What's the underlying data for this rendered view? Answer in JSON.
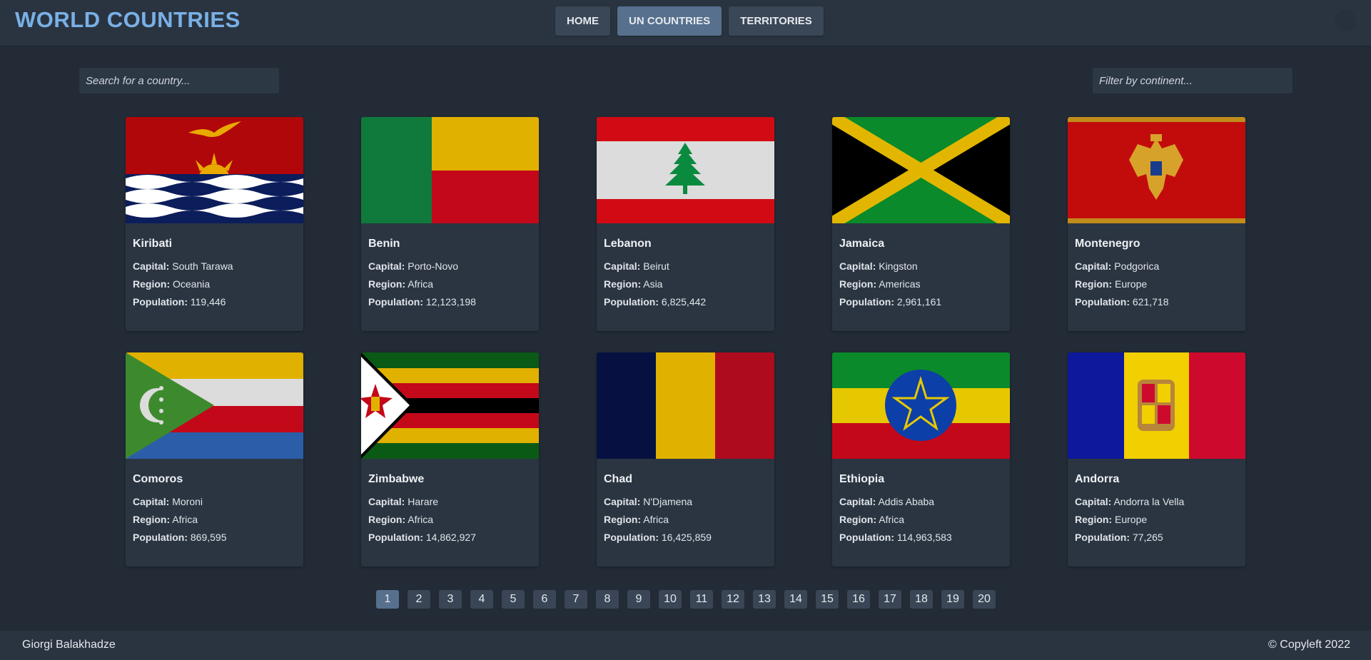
{
  "header": {
    "brand": "WORLD COUNTRIES",
    "nav": [
      {
        "label": "HOME",
        "active": false
      },
      {
        "label": "UN COUNTRIES",
        "active": true
      },
      {
        "label": "TERRITORIES",
        "active": false
      }
    ]
  },
  "search": {
    "placeholder": "Search for a country..."
  },
  "filter": {
    "placeholder": "Filter by continent..."
  },
  "field_labels": {
    "capital": "Capital:",
    "region": "Region:",
    "population": "Population:"
  },
  "countries": [
    {
      "name": "Kiribati",
      "capital": "South Tarawa",
      "region": "Oceania",
      "population": "119,446",
      "flag": "kiribati-flag-icon"
    },
    {
      "name": "Benin",
      "capital": "Porto-Novo",
      "region": "Africa",
      "population": "12,123,198",
      "flag": "benin-flag-icon"
    },
    {
      "name": "Lebanon",
      "capital": "Beirut",
      "region": "Asia",
      "population": "6,825,442",
      "flag": "lebanon-flag-icon"
    },
    {
      "name": "Jamaica",
      "capital": "Kingston",
      "region": "Americas",
      "population": "2,961,161",
      "flag": "jamaica-flag-icon"
    },
    {
      "name": "Montenegro",
      "capital": "Podgorica",
      "region": "Europe",
      "population": "621,718",
      "flag": "montenegro-flag-icon"
    },
    {
      "name": "Comoros",
      "capital": "Moroni",
      "region": "Africa",
      "population": "869,595",
      "flag": "comoros-flag-icon"
    },
    {
      "name": "Zimbabwe",
      "capital": "Harare",
      "region": "Africa",
      "population": "14,862,927",
      "flag": "zimbabwe-flag-icon"
    },
    {
      "name": "Chad",
      "capital": "N'Djamena",
      "region": "Africa",
      "population": "16,425,859",
      "flag": "chad-flag-icon"
    },
    {
      "name": "Ethiopia",
      "capital": "Addis Ababa",
      "region": "Africa",
      "population": "114,963,583",
      "flag": "ethiopia-flag-icon"
    },
    {
      "name": "Andorra",
      "capital": "Andorra la Vella",
      "region": "Europe",
      "population": "77,265",
      "flag": "andorra-flag-icon"
    }
  ],
  "pagination": {
    "pages": [
      "1",
      "2",
      "3",
      "4",
      "5",
      "6",
      "7",
      "8",
      "9",
      "10",
      "11",
      "12",
      "13",
      "14",
      "15",
      "16",
      "17",
      "18",
      "19",
      "20"
    ],
    "current": "1"
  },
  "footer": {
    "author": "Giorgi Balakhadze",
    "copyright": "© Copyleft 2022"
  }
}
